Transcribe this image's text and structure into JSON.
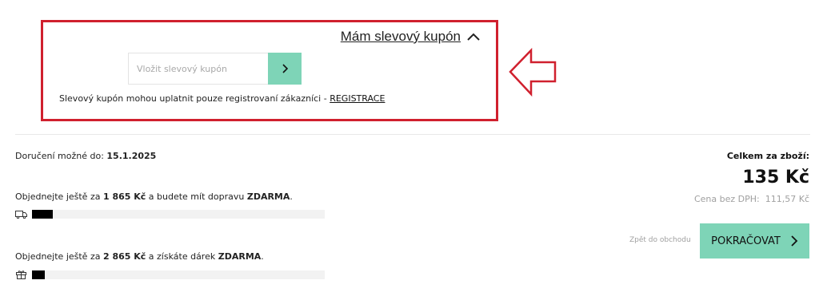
{
  "coupon": {
    "toggle_label": "Mám slevový kupón",
    "input_placeholder": "Vložit slevový kupón",
    "note_text": "Slevový kupón mohou uplatnit pouze registrovaní zákazníci - ",
    "note_link": "REGISTRACE"
  },
  "delivery": {
    "label": "Doručení možné do: ",
    "date": "15.1.2025"
  },
  "free_shipping": {
    "prefix": "Objednejte ještě za ",
    "amount": "1 865 Kč",
    "middle": " a budete mít dopravu ",
    "reward": "ZDARMA",
    "suffix": ".",
    "progress": 0.07
  },
  "free_gift": {
    "prefix": "Objednejte ještě za ",
    "amount": "2 865 Kč",
    "middle": " a získáte dárek ",
    "reward": "ZDARMA",
    "suffix": ".",
    "progress": 0.045
  },
  "summary": {
    "label": "Celkem za zboží:",
    "total": "135 Kč",
    "vat_label": "Cena bez DPH:",
    "vat_value": "111,57 Kč"
  },
  "actions": {
    "back_label": "Zpět do obchodu",
    "continue_label": "POKRAČOVAT"
  },
  "colors": {
    "accent": "#7ed4b7",
    "highlight_border": "#d0202e"
  }
}
